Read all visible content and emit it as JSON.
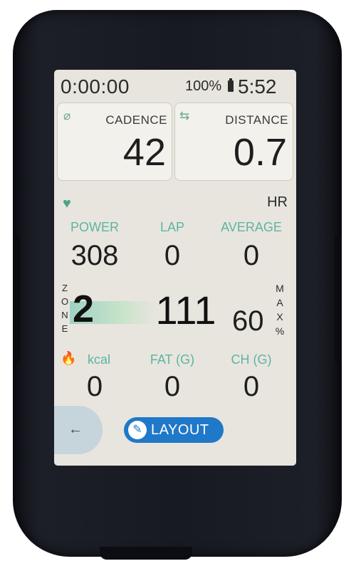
{
  "status": {
    "timer": "0:00:00",
    "battery": "100%",
    "clock": "5:52"
  },
  "tiles": [
    {
      "label": "CADENCE",
      "value": "42",
      "icon": "cadence-icon"
    },
    {
      "label": "DISTANCE",
      "value": "0.7",
      "icon": "route-icon"
    }
  ],
  "hr": {
    "title": "HR",
    "columns": [
      {
        "label": "POWER",
        "value": "308"
      },
      {
        "label": "LAP",
        "value": "0"
      },
      {
        "label": "AVERAGE",
        "value": "0"
      }
    ],
    "zone_letters": "ZONE",
    "zone": "2",
    "current": "111",
    "max_percent": "60",
    "max_letters": "MAX%",
    "bottom": [
      {
        "label": "kcal",
        "value": "0"
      },
      {
        "label": "FAT (G)",
        "value": "0"
      },
      {
        "label": "CH (G)",
        "value": "0"
      }
    ]
  },
  "nav": {
    "back_icon": "←",
    "layout_label": "LAYOUT"
  },
  "colors": {
    "accent": "#5cb5a2",
    "button": "#1f78c8",
    "screen": "#e8e5de"
  }
}
